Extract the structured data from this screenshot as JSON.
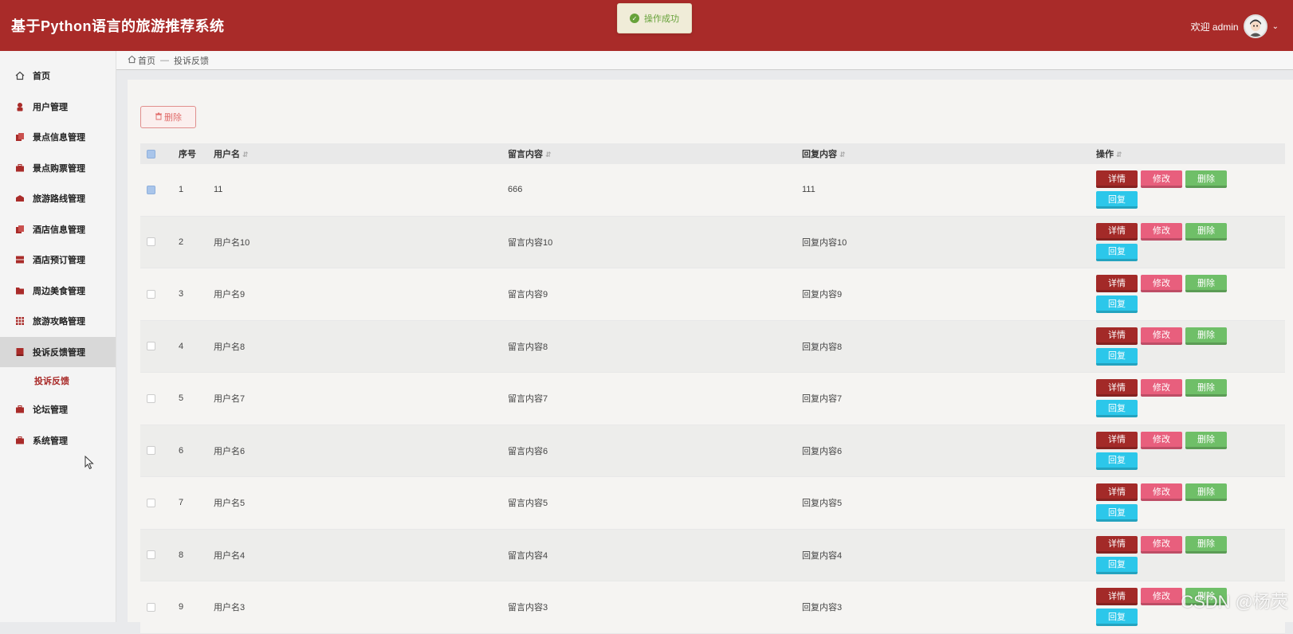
{
  "header": {
    "title": "基于Python语言的旅游推荐系统",
    "welcome": "欢迎 admin"
  },
  "toast": {
    "text": "操作成功"
  },
  "breadcrumb": {
    "home": "首页",
    "separator": "—",
    "current": "投诉反馈"
  },
  "sidebar": {
    "items": [
      {
        "label": "首页",
        "icon": "home-icon"
      },
      {
        "label": "用户管理",
        "icon": "user-icon"
      },
      {
        "label": "景点信息管理",
        "icon": "copy-icon"
      },
      {
        "label": "景点购票管理",
        "icon": "briefcase-icon"
      },
      {
        "label": "旅游路线管理",
        "icon": "route-icon"
      },
      {
        "label": "酒店信息管理",
        "icon": "copy-icon"
      },
      {
        "label": "酒店预订管理",
        "icon": "server-icon"
      },
      {
        "label": "周边美食管理",
        "icon": "folder-icon"
      },
      {
        "label": "旅游攻略管理",
        "icon": "grid-icon"
      },
      {
        "label": "投诉反馈管理",
        "icon": "book-icon"
      },
      {
        "label": "论坛管理",
        "icon": "briefcase-icon"
      },
      {
        "label": "系统管理",
        "icon": "briefcase-icon"
      }
    ],
    "sub_item": "投诉反馈"
  },
  "toolbar": {
    "delete_label": "删除"
  },
  "table": {
    "headers": {
      "no": "序号",
      "user": "用户名",
      "msg": "留言内容",
      "reply": "回复内容",
      "op": "操作"
    },
    "rows": [
      {
        "no": "1",
        "user": "11",
        "msg": "666",
        "reply": "111"
      },
      {
        "no": "2",
        "user": "用户名10",
        "msg": "留言内容10",
        "reply": "回复内容10"
      },
      {
        "no": "3",
        "user": "用户名9",
        "msg": "留言内容9",
        "reply": "回复内容9"
      },
      {
        "no": "4",
        "user": "用户名8",
        "msg": "留言内容8",
        "reply": "回复内容8"
      },
      {
        "no": "5",
        "user": "用户名7",
        "msg": "留言内容7",
        "reply": "回复内容7"
      },
      {
        "no": "6",
        "user": "用户名6",
        "msg": "留言内容6",
        "reply": "回复内容6"
      },
      {
        "no": "7",
        "user": "用户名5",
        "msg": "留言内容5",
        "reply": "回复内容5"
      },
      {
        "no": "8",
        "user": "用户名4",
        "msg": "留言内容4",
        "reply": "回复内容4"
      },
      {
        "no": "9",
        "user": "用户名3",
        "msg": "留言内容3",
        "reply": "回复内容3"
      }
    ],
    "ops": {
      "detail": "详情",
      "edit": "修改",
      "delete": "删除",
      "reply": "回复"
    }
  },
  "watermark": "CSDN @杨荧",
  "colors": {
    "brand": "#a92b29",
    "detail": "#a32a28",
    "edit": "#e85f7d",
    "delete": "#6fbf68",
    "reply": "#2cc7ea"
  }
}
